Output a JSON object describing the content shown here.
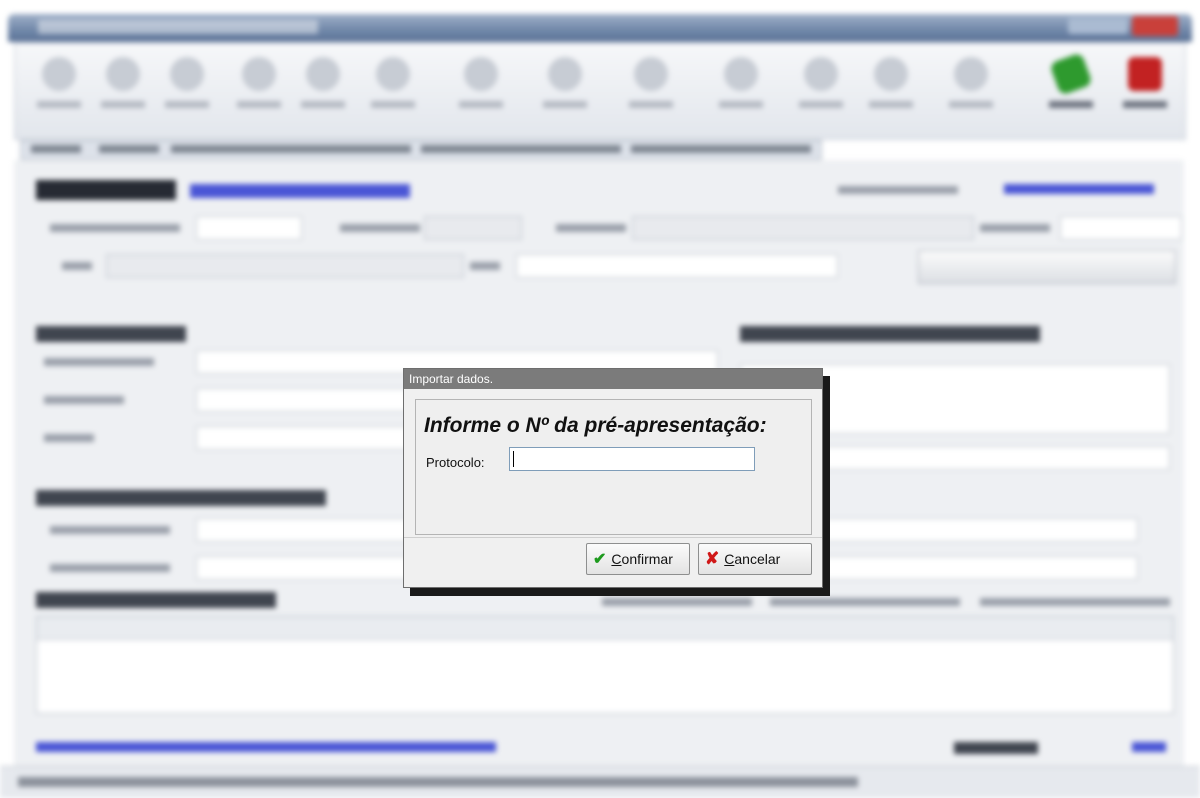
{
  "dialog": {
    "title": "Importar dados.",
    "prompt": "Informe o Nº da pré-apresentação:",
    "protocol_label": "Protocolo:",
    "protocol_value": "",
    "confirm": {
      "mnemonic": "C",
      "rest": "onfirmar"
    },
    "cancel": {
      "mnemonic": "C",
      "rest": "ancelar"
    }
  },
  "icons": {
    "confirm": "check-icon",
    "cancel": "x-icon"
  },
  "colors": {
    "check": "#1e9a1e",
    "cancel_x": "#d01818",
    "titlebar": "#7b7b7b"
  }
}
